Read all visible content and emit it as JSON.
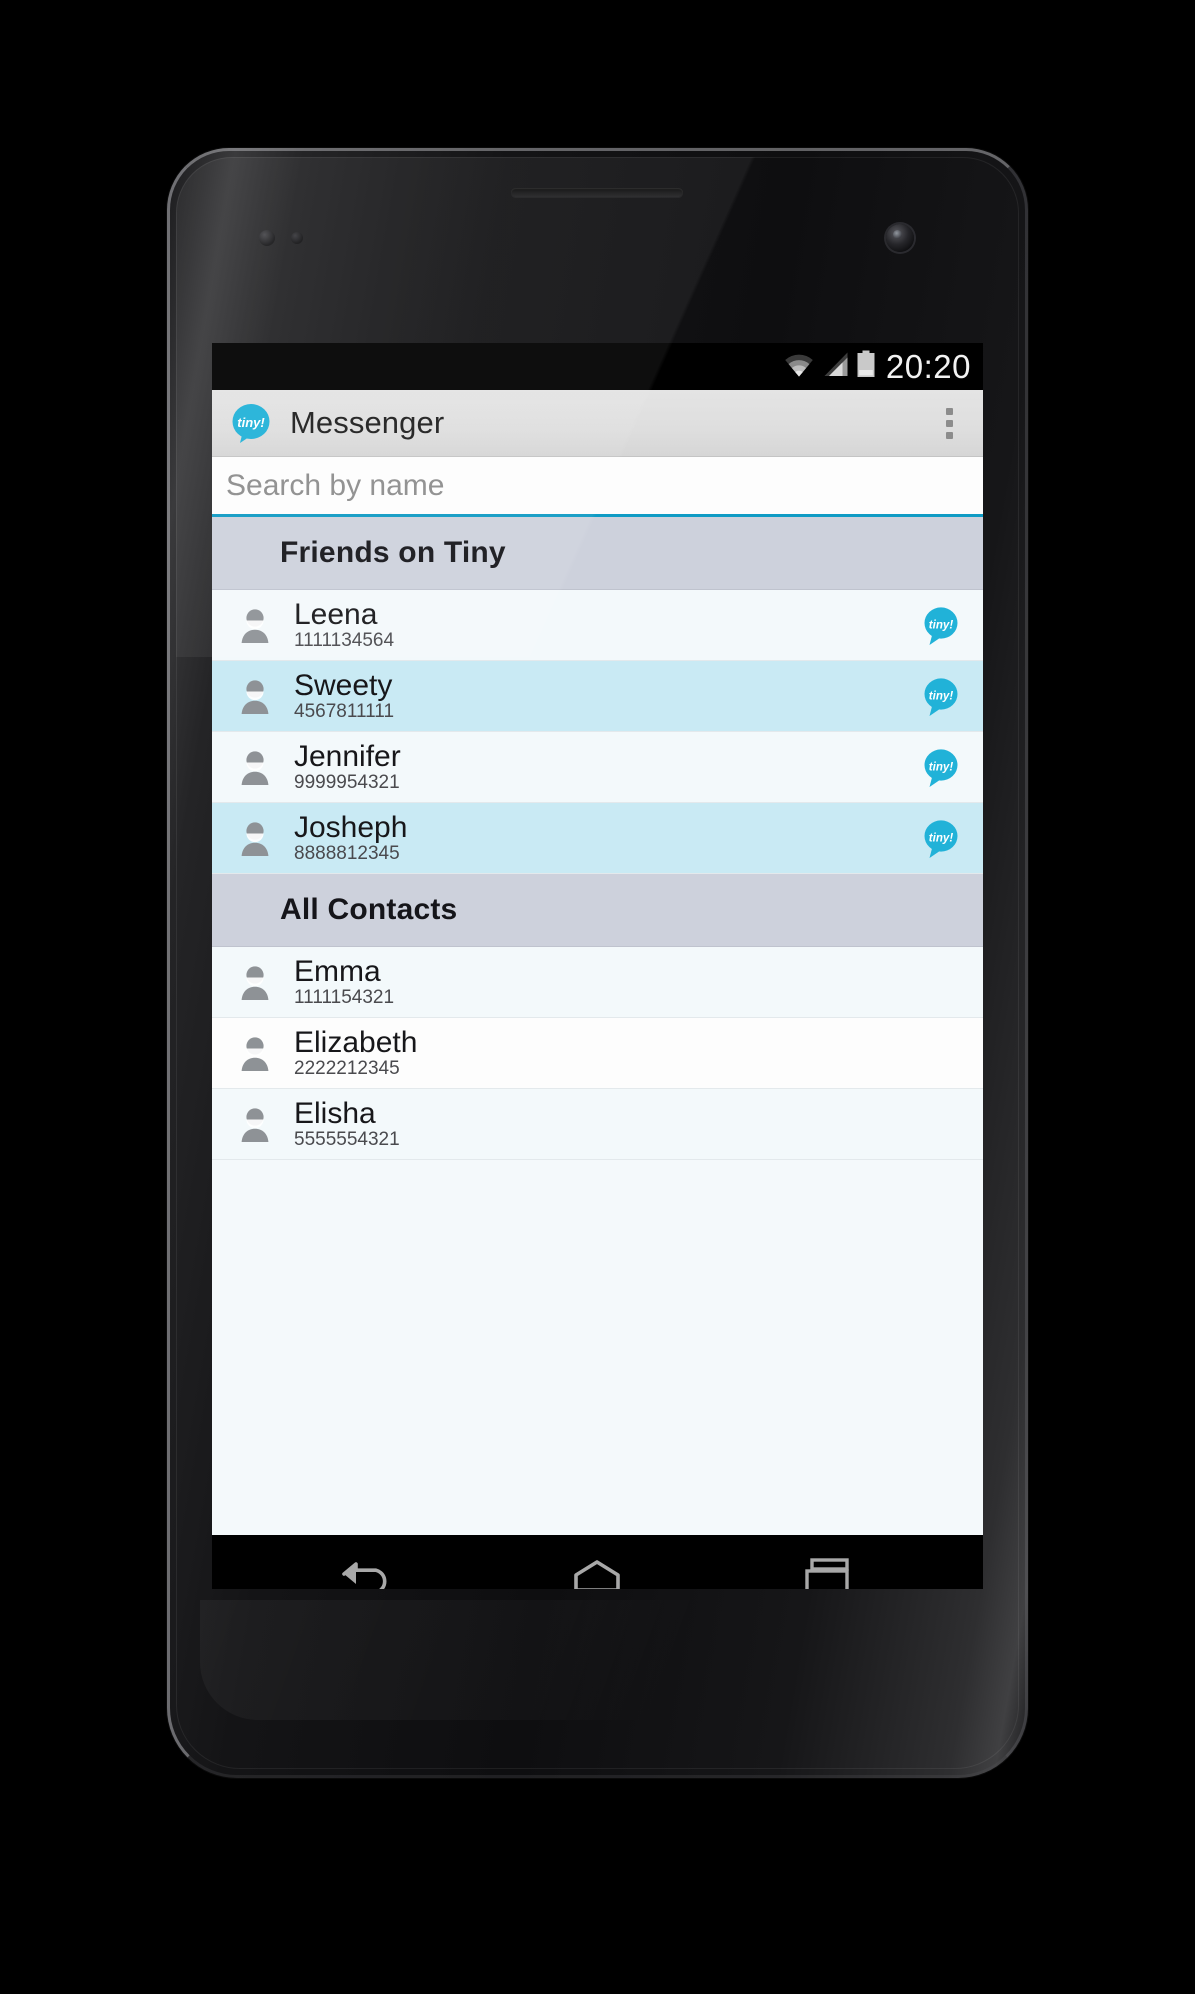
{
  "device": {
    "kind": "android-phone-mockup"
  },
  "status_bar": {
    "wifi_icon": "wifi-icon",
    "signal_icon": "cellular-signal-icon",
    "battery_icon": "battery-icon",
    "clock": "20:20"
  },
  "action_bar": {
    "app_icon": "tiny-speech-bubble-icon",
    "app_icon_label": "tiny!",
    "title": "Messenger",
    "overflow_icon": "overflow-menu-icon"
  },
  "search": {
    "placeholder": "Search by name",
    "value": "",
    "accent_color": "#0f9bc4"
  },
  "sections": [
    {
      "header": "Friends on Tiny",
      "contacts": [
        {
          "name": "Leena",
          "number": "1111134564",
          "has_tiny": true,
          "row_style": "bg-a"
        },
        {
          "name": "Sweety",
          "number": "4567811111",
          "has_tiny": true,
          "row_style": "bg-b"
        },
        {
          "name": "Jennifer",
          "number": "9999954321",
          "has_tiny": true,
          "row_style": "bg-a"
        },
        {
          "name": "Josheph",
          "number": "8888812345",
          "has_tiny": true,
          "row_style": "bg-b"
        }
      ]
    },
    {
      "header": "All Contacts",
      "contacts": [
        {
          "name": "Emma",
          "number": "1111154321",
          "has_tiny": false,
          "row_style": "bg-a"
        },
        {
          "name": "Elizabeth",
          "number": "2222212345",
          "has_tiny": false,
          "row_style": "bg-c"
        },
        {
          "name": "Elisha",
          "number": "5555554321",
          "has_tiny": false,
          "row_style": "bg-a"
        }
      ]
    }
  ],
  "nav_bar": {
    "back_icon": "back-arrow-icon",
    "home_icon": "home-icon",
    "recents_icon": "recent-apps-icon"
  },
  "colors": {
    "brand_cyan": "#21b2d8",
    "badge_cyan": "#21b2d8",
    "section_header_bg": "#cdd1dc",
    "row_highlight_bg": "#c9eaf4",
    "row_default_bg": "#f3f9fb",
    "action_bar_bg": "#dedede",
    "search_underline": "#0f9bc4"
  },
  "tiny_badge_label": "tiny!"
}
